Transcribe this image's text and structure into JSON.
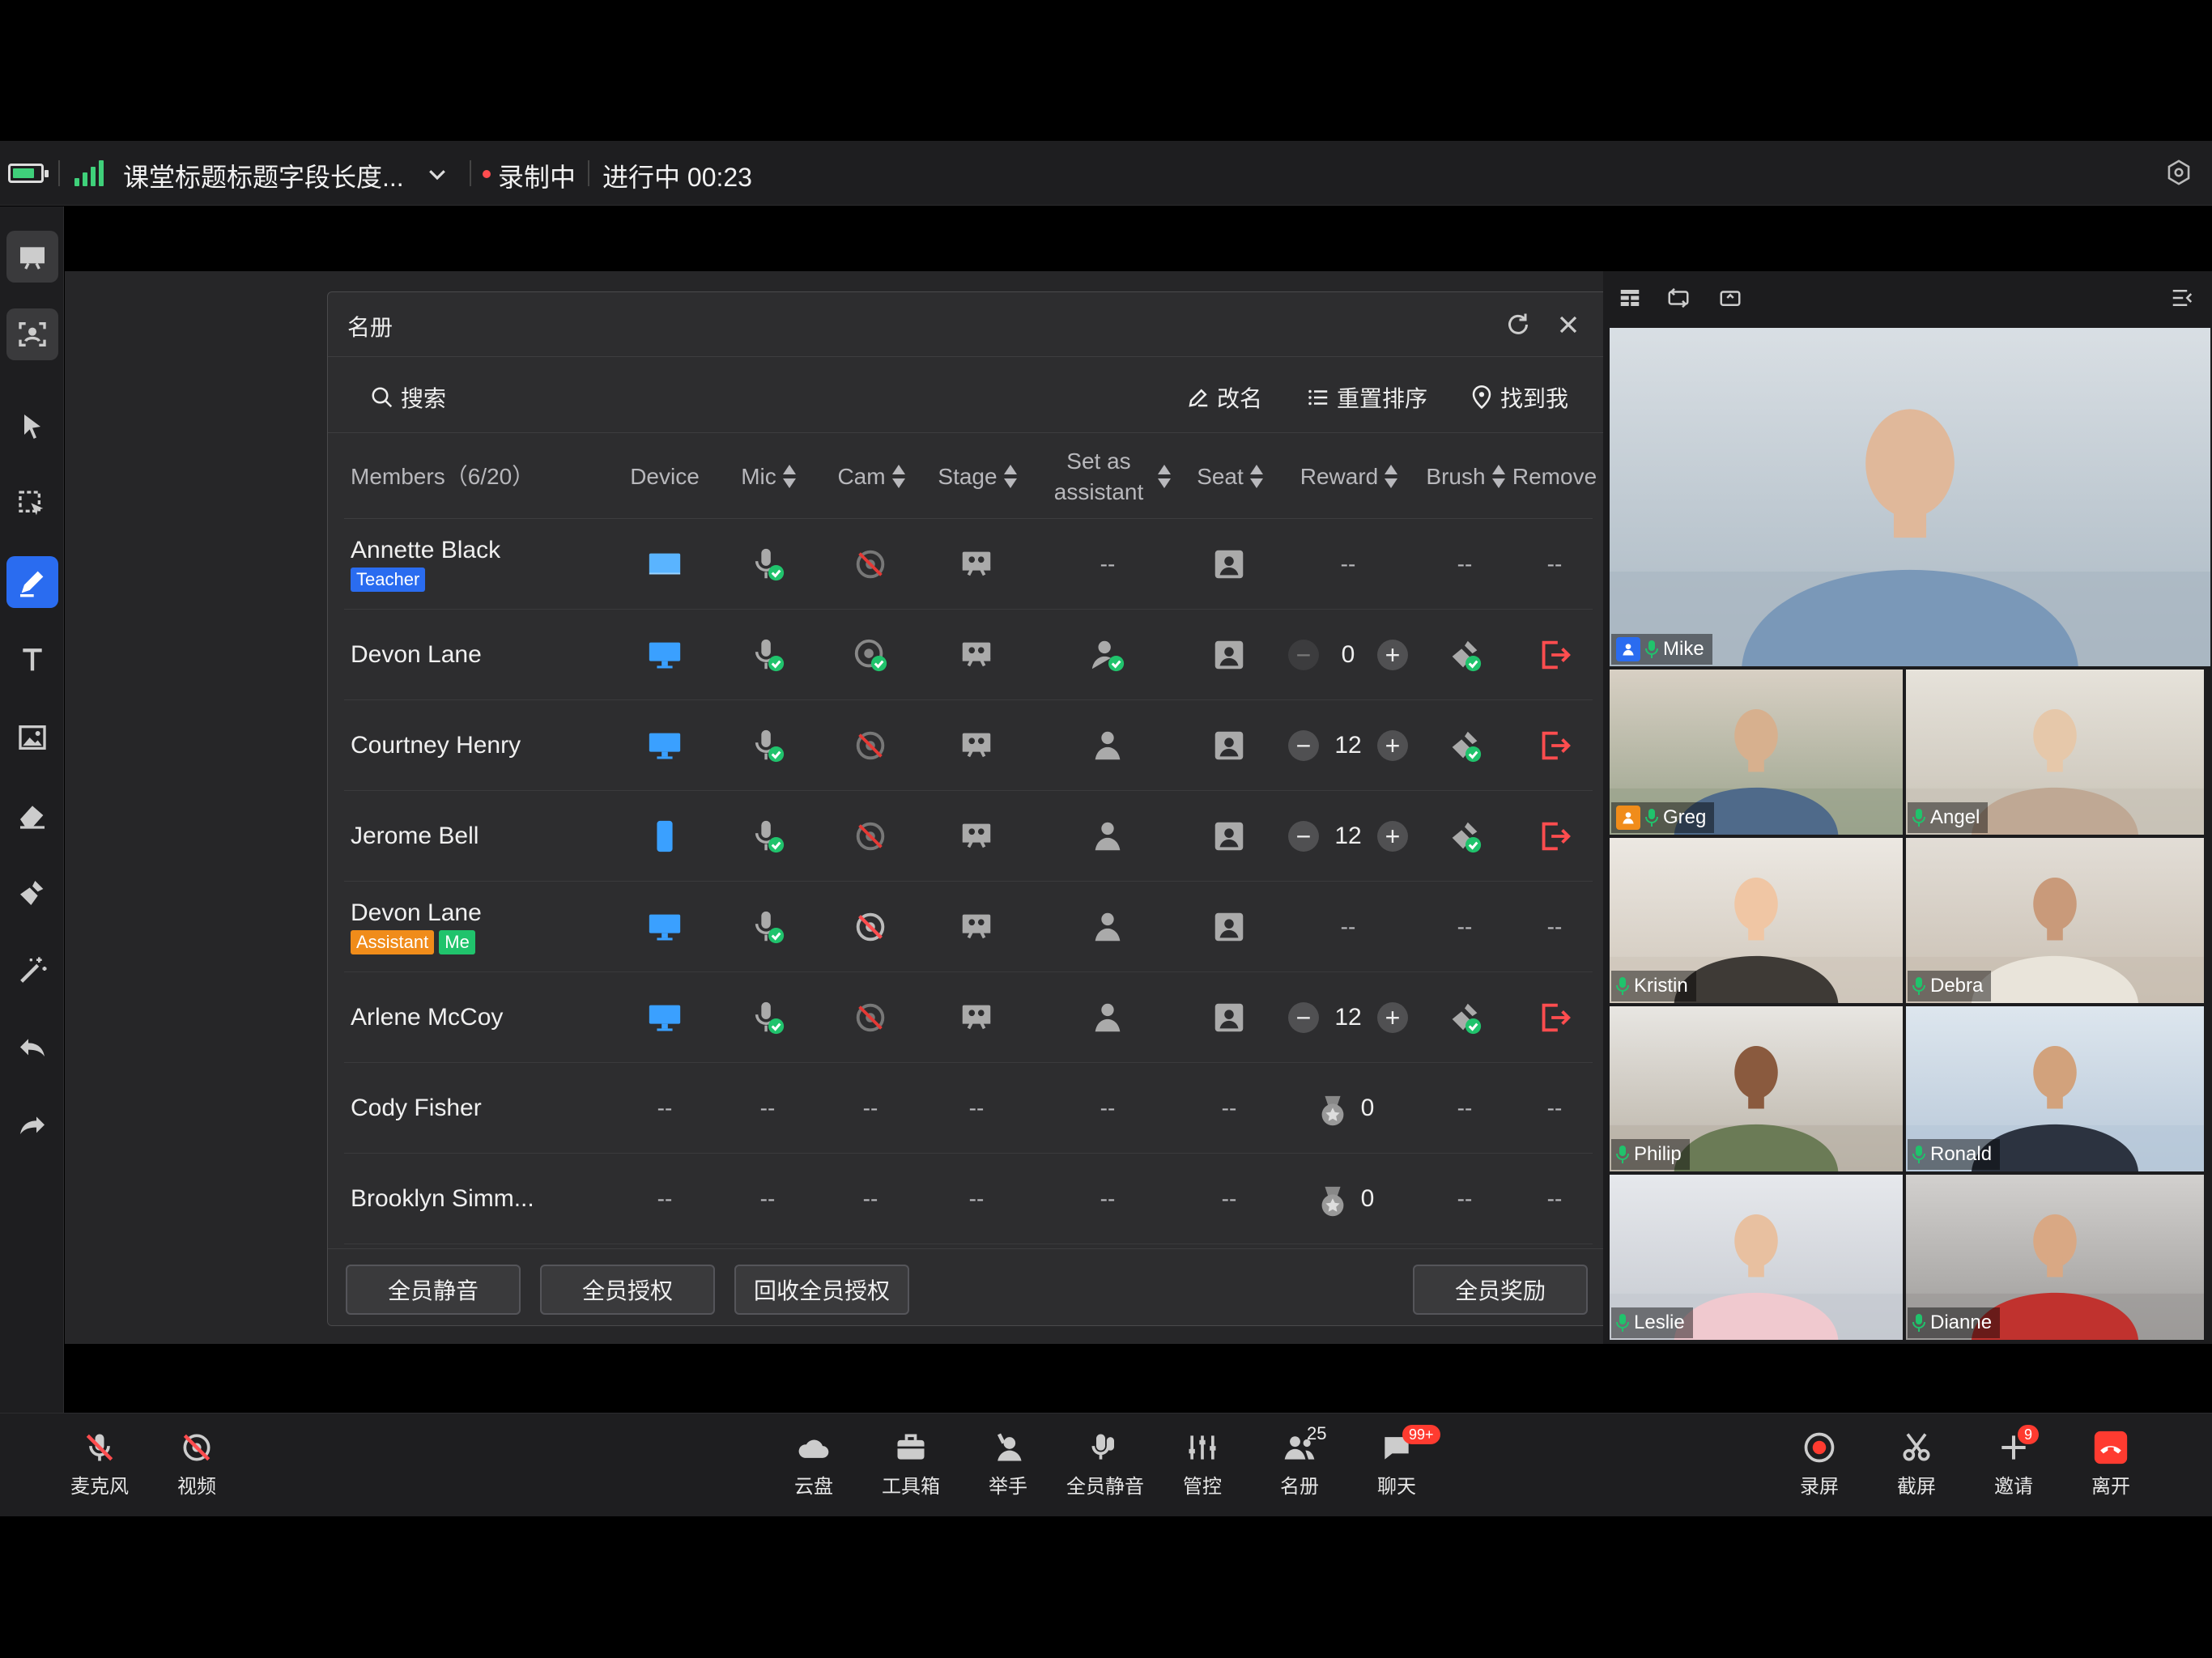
{
  "topbar": {
    "class_title": "课堂标题标题字段长度...",
    "recording": "录制中",
    "status": "进行中 00:23",
    "battery_icon": "battery-icon",
    "signal_icon": "signal-icon"
  },
  "roster": {
    "title": "名册",
    "search_label": "搜索",
    "rename": "改名",
    "reorder": "重置排序",
    "find_me": "找到我",
    "columns": {
      "members": "Members（6/20）",
      "device": "Device",
      "mic": "Mic",
      "cam": "Cam",
      "stage": "Stage",
      "assistant": "Set as assistant",
      "seat": "Seat",
      "reward": "Reward",
      "brush": "Brush",
      "remove": "Remove"
    },
    "rows": [
      {
        "name": "Annette Black",
        "badges": [
          "Teacher"
        ],
        "device": "desktop-light",
        "reward": "--",
        "brush": "--",
        "remove": "--",
        "assistant": "--"
      },
      {
        "name": "Devon Lane",
        "badges": [],
        "device": "desktop",
        "reward": "0",
        "brush": "brush",
        "remove": "remove",
        "assistant": "assistant-on"
      },
      {
        "name": "Courtney Henry",
        "badges": [],
        "device": "desktop",
        "reward": "12",
        "brush": "brush",
        "remove": "remove",
        "assistant": "assistant"
      },
      {
        "name": "Jerome Bell",
        "badges": [],
        "device": "phone",
        "reward": "12",
        "brush": "brush",
        "remove": "remove",
        "assistant": "assistant"
      },
      {
        "name": "Devon Lane",
        "badges": [
          "Assistant",
          "Me"
        ],
        "device": "desktop",
        "reward": "--",
        "brush": "--",
        "remove": "--",
        "assistant": "assistant"
      },
      {
        "name": "Arlene McCoy",
        "badges": [],
        "device": "desktop",
        "reward": "12",
        "brush": "brush",
        "remove": "remove",
        "assistant": "assistant"
      },
      {
        "name": "Cody Fisher",
        "badges": [],
        "device": "--",
        "reward": "0",
        "brush": "--",
        "remove": "--",
        "assistant": "--"
      },
      {
        "name": "Brooklyn Simm...",
        "badges": [],
        "device": "--",
        "reward": "0",
        "brush": "--",
        "remove": "--",
        "assistant": "--"
      }
    ],
    "footer": {
      "mute_all": "全员静音",
      "authorize_all": "全员授权",
      "revoke_all": "回收全员授权",
      "reward_all": "全员奖励"
    }
  },
  "videos": [
    {
      "name": "Mike",
      "role": "teacher",
      "role_color": "#2a6cf0"
    },
    {
      "name": "Greg",
      "role": "assistant",
      "role_color": "#f08c1a"
    },
    {
      "name": "Angel"
    },
    {
      "name": "Kristin"
    },
    {
      "name": "Debra"
    },
    {
      "name": "Philip"
    },
    {
      "name": "Ronald"
    },
    {
      "name": "Leslie"
    },
    {
      "name": "Dianne"
    }
  ],
  "bottombar": {
    "mic": "麦克风",
    "video": "视频",
    "cloud": "云盘",
    "toolbox": "工具箱",
    "raise_hand": "举手",
    "mute_all": "全员静音",
    "control": "管控",
    "roster": "名册",
    "roster_count": "25",
    "chat": "聊天",
    "chat_badge": "99+",
    "record": "录屏",
    "screenshot": "截屏",
    "invite": "邀请",
    "invite_badge": "9",
    "leave": "离开"
  },
  "colors": {
    "accent": "#2a6cf0",
    "mic_ok": "#20c36c",
    "danger": "#ff4d4f",
    "recording_dot": "#ff4d4f"
  }
}
